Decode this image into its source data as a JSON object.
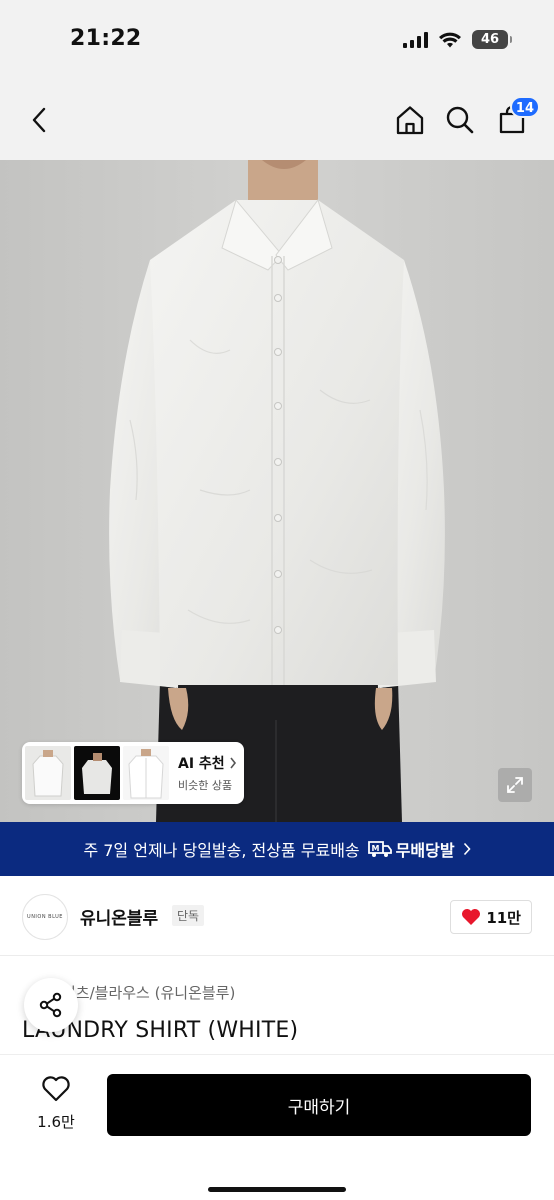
{
  "status": {
    "time": "21:22",
    "battery": "46"
  },
  "nav": {
    "cart_count": "14"
  },
  "ai_recommend": {
    "title": "AI 추천",
    "subtitle": "비슷한 상품"
  },
  "shipping": {
    "text": "주 7일 언제나 당일발송, 전상품 무료배송",
    "brand": "무배당발"
  },
  "brand": {
    "logo_text": "UNION BLUE",
    "name": "유니온블루",
    "tag": "단독",
    "likes": "11만"
  },
  "product": {
    "category": "셔츠/블라우스 (유니온블루)",
    "title": "LAUNDRY SHIRT (WHITE)"
  },
  "bottom": {
    "wish_count": "1.6만",
    "buy_label": "구매하기"
  },
  "colors": {
    "accent_blue": "#1e6bff",
    "banner_navy": "#0b2a80",
    "heart_red": "#e8172c"
  },
  "icons": [
    "back-icon",
    "home-icon",
    "search-icon",
    "cart-icon",
    "expand-icon",
    "share-icon",
    "heart-icon",
    "truck-icon"
  ]
}
